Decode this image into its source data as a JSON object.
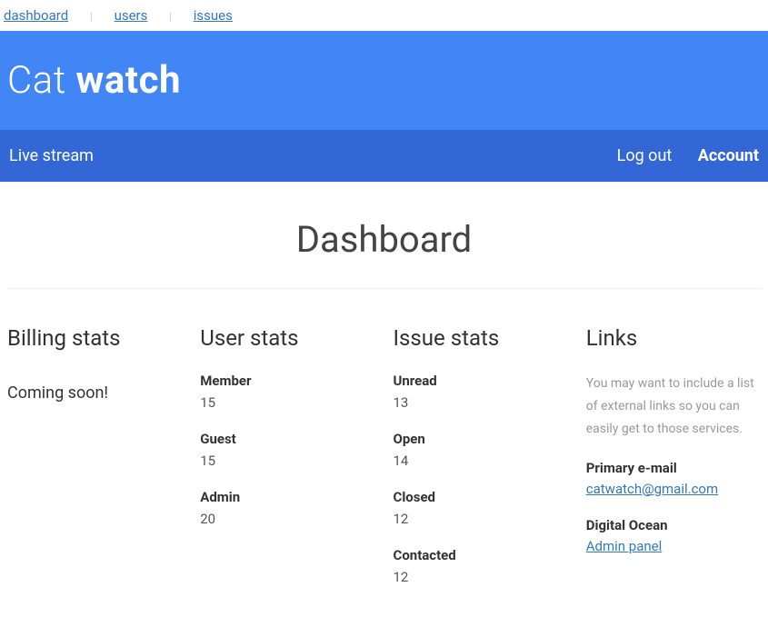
{
  "topnav": {
    "dashboard": "dashboard",
    "users": "users",
    "issues": "issues"
  },
  "brand": {
    "prefix": "Cat ",
    "bold": "watch"
  },
  "subnav": {
    "live_stream": "Live stream",
    "logout": "Log out",
    "account": "Account"
  },
  "page_title": "Dashboard",
  "billing": {
    "heading": "Billing stats",
    "coming_soon": "Coming soon!"
  },
  "user_stats": {
    "heading": "User stats",
    "member_label": "Member",
    "member_value": "15",
    "guest_label": "Guest",
    "guest_value": "15",
    "admin_label": "Admin",
    "admin_value": "20"
  },
  "issue_stats": {
    "heading": "Issue stats",
    "unread_label": "Unread",
    "unread_value": "13",
    "open_label": "Open",
    "open_value": "14",
    "closed_label": "Closed",
    "closed_value": "12",
    "contacted_label": "Contacted",
    "contacted_value": "12"
  },
  "links": {
    "heading": "Links",
    "description": "You may want to include a list of external links so you can easily get to those services.",
    "email_label": "Primary e-mail",
    "email_value": "catwatch@gmail.com",
    "do_label": "Digital Ocean",
    "do_value": "Admin panel"
  }
}
